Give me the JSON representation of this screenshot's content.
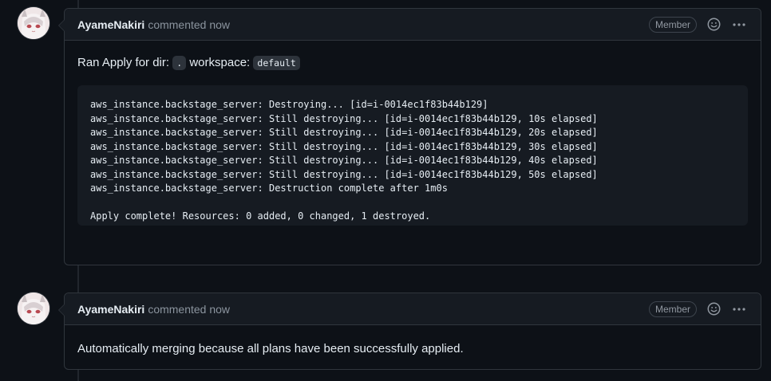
{
  "comments": [
    {
      "author": "AyameNakiri",
      "meta": "commented now",
      "badge": "Member",
      "body_prefix": "Ran Apply for dir:",
      "dir": ".",
      "body_mid": "workspace:",
      "workspace": "default",
      "output_lines": [
        "aws_instance.backstage_server: Destroying... [id=i-0014ec1f83b44b129]",
        "aws_instance.backstage_server: Still destroying... [id=i-0014ec1f83b44b129, 10s elapsed]",
        "aws_instance.backstage_server: Still destroying... [id=i-0014ec1f83b44b129, 20s elapsed]",
        "aws_instance.backstage_server: Still destroying... [id=i-0014ec1f83b44b129, 30s elapsed]",
        "aws_instance.backstage_server: Still destroying... [id=i-0014ec1f83b44b129, 40s elapsed]",
        "aws_instance.backstage_server: Still destroying... [id=i-0014ec1f83b44b129, 50s elapsed]",
        "aws_instance.backstage_server: Destruction complete after 1m0s",
        "",
        "Apply complete! Resources: 0 added, 0 changed, 1 destroyed."
      ]
    },
    {
      "author": "AyameNakiri",
      "meta": "commented now",
      "badge": "Member",
      "body": "Automatically merging because all plans have been successfully applied."
    }
  ],
  "icons": {
    "reaction": "smiley-icon",
    "more": "kebab-horizontal-icon"
  },
  "colors": {
    "background": "#0d1117",
    "header": "#161b22",
    "border": "#30363d",
    "muted_text": "#8b949e",
    "text": "#e6edf3"
  }
}
